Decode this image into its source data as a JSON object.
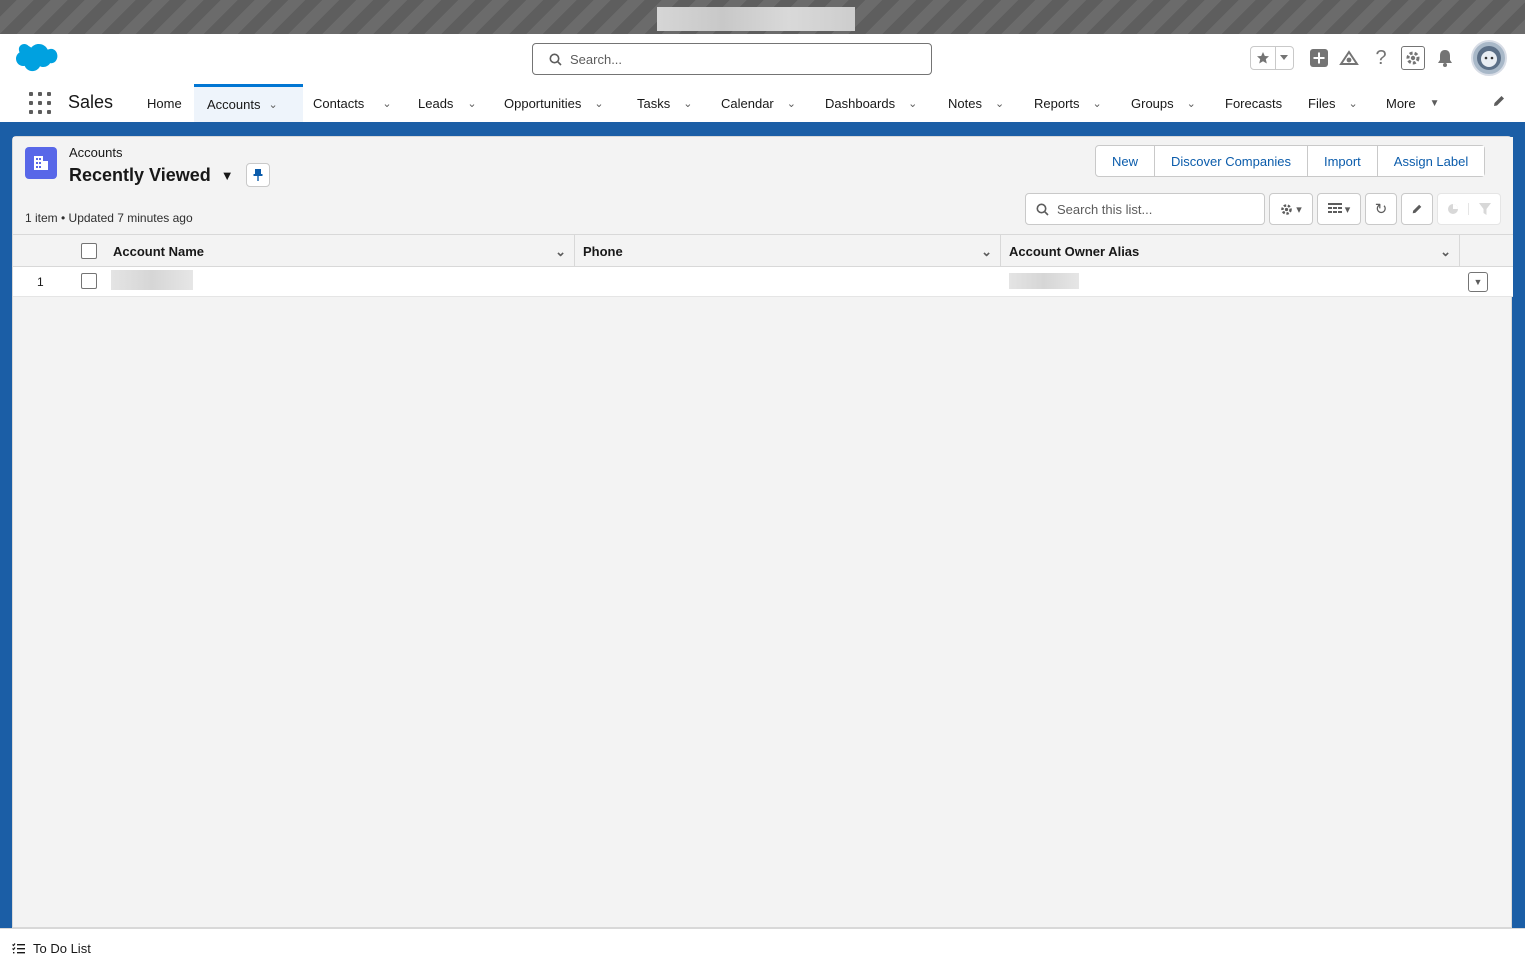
{
  "header": {
    "search_placeholder": "Search...",
    "icons": [
      "favorites-star-icon",
      "global-actions-plus-icon",
      "trailhead-icon",
      "help-icon",
      "setup-gear-icon",
      "notifications-bell-icon"
    ]
  },
  "nav": {
    "app_name": "Sales",
    "items": [
      {
        "label": "Home",
        "has_menu": false
      },
      {
        "label": "Accounts",
        "has_menu": true,
        "active": true
      },
      {
        "label": "Contacts",
        "has_menu": true
      },
      {
        "label": "Leads",
        "has_menu": true
      },
      {
        "label": "Opportunities",
        "has_menu": true
      },
      {
        "label": "Tasks",
        "has_menu": true
      },
      {
        "label": "Calendar",
        "has_menu": true
      },
      {
        "label": "Dashboards",
        "has_menu": true
      },
      {
        "label": "Notes",
        "has_menu": true
      },
      {
        "label": "Reports",
        "has_menu": true
      },
      {
        "label": "Groups",
        "has_menu": true
      },
      {
        "label": "Forecasts",
        "has_menu": false
      },
      {
        "label": "Files",
        "has_menu": true
      },
      {
        "label": "More",
        "has_menu": true
      }
    ]
  },
  "list_view": {
    "object_label": "Accounts",
    "title": "Recently Viewed",
    "meta": "1 item • Updated 7 minutes ago",
    "search_placeholder": "Search this list...",
    "actions": [
      "New",
      "Discover Companies",
      "Import",
      "Assign Label"
    ],
    "columns": [
      "Account Name",
      "Phone",
      "Account Owner Alias"
    ],
    "rows": [
      {
        "number": "1",
        "account_name": "",
        "phone": "",
        "owner_alias": ""
      }
    ]
  },
  "footer": {
    "todo_label": "To Do List"
  },
  "colors": {
    "brand_blue": "#0176d3",
    "banner_blue": "#1b5ea6",
    "object_icon": "#5867e8",
    "link_blue": "#0b5cab"
  }
}
